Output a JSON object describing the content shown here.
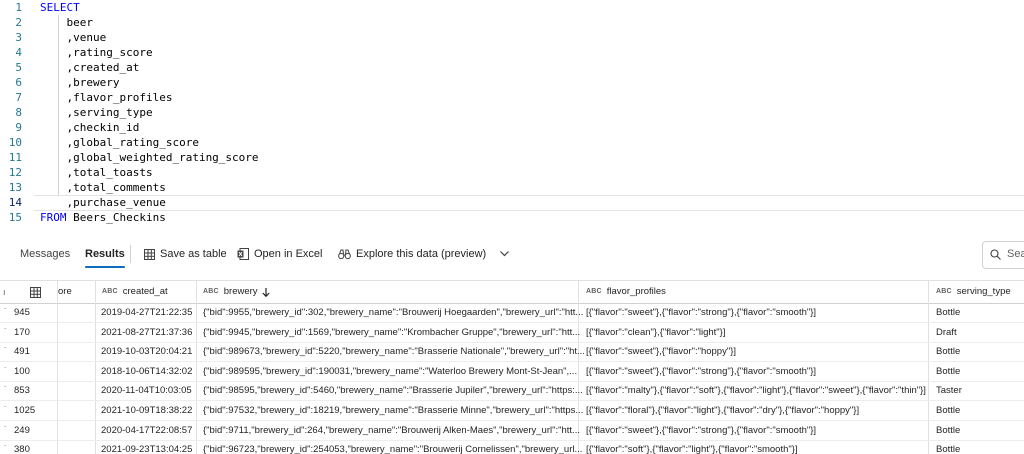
{
  "editor": {
    "lines": [
      {
        "n": "1",
        "kw": "SELECT",
        "text": ""
      },
      {
        "n": "2",
        "kw": "",
        "text": "    beer"
      },
      {
        "n": "3",
        "kw": "",
        "text": "    ,venue"
      },
      {
        "n": "4",
        "kw": "",
        "text": "    ,rating_score"
      },
      {
        "n": "5",
        "kw": "",
        "text": "    ,created_at"
      },
      {
        "n": "6",
        "kw": "",
        "text": "    ,brewery"
      },
      {
        "n": "7",
        "kw": "",
        "text": "    ,flavor_profiles"
      },
      {
        "n": "8",
        "kw": "",
        "text": "    ,serving_type"
      },
      {
        "n": "9",
        "kw": "",
        "text": "    ,checkin_id"
      },
      {
        "n": "10",
        "kw": "",
        "text": "    ,global_rating_score"
      },
      {
        "n": "11",
        "kw": "",
        "text": "    ,global_weighted_rating_score"
      },
      {
        "n": "12",
        "kw": "",
        "text": "    ,total_toasts"
      },
      {
        "n": "13",
        "kw": "",
        "text": "    ,total_comments"
      },
      {
        "n": "14",
        "kw": "",
        "text": "    ,purchase_venue"
      },
      {
        "n": "15",
        "kw": "FROM",
        "text": " Beers_Checkins"
      }
    ]
  },
  "toolbar": {
    "tabs": [
      "Messages",
      "Results"
    ],
    "save_as_table": "Save as table",
    "open_in_excel": "Open in Excel",
    "explore": "Explore this data (preview)",
    "search_placeholder": "Sea"
  },
  "grid": {
    "columns": [
      {
        "type": "",
        "label": "ore"
      },
      {
        "type": "ABC",
        "label": "created_at"
      },
      {
        "type": "ABC",
        "label": "brewery"
      },
      {
        "type": "ABC",
        "label": "flavor_profiles"
      },
      {
        "type": "ABC",
        "label": "serving_type"
      }
    ],
    "rows": [
      {
        "c0": "945",
        "created_at": "2019-04-27T21:22:35",
        "brewery": "{\"bid\":9955,\"brewery_id\":302,\"brewery_name\":\"Brouwerij Hoegaarden\",\"brewery_url\":\"htt...",
        "flavor": "[{\"flavor\":\"sweet\"},{\"flavor\":\"strong\"},{\"flavor\":\"smooth\"}]",
        "serving": "Bottle"
      },
      {
        "c0": "170",
        "created_at": "2021-08-27T21:37:36",
        "brewery": "{\"bid\":9945,\"brewery_id\":1569,\"brewery_name\":\"Krombacher Gruppe\",\"brewery_url\":\"htt...",
        "flavor": "[{\"flavor\":\"clean\"},{\"flavor\":\"light\"}]",
        "serving": "Draft"
      },
      {
        "c0": "491",
        "created_at": "2019-10-03T20:04:21",
        "brewery": "{\"bid\":989673,\"brewery_id\":5220,\"brewery_name\":\"Brasserie Nationale\",\"brewery_url\":\"ht...",
        "flavor": "[{\"flavor\":\"sweet\"},{\"flavor\":\"hoppy\"}]",
        "serving": "Bottle"
      },
      {
        "c0": "100",
        "created_at": "2018-10-06T14:32:02",
        "brewery": "{\"bid\":989595,\"brewery_id\":190031,\"brewery_name\":\"Waterloo Brewery Mont-St-Jean\",...",
        "flavor": "[{\"flavor\":\"sweet\"},{\"flavor\":\"strong\"},{\"flavor\":\"smooth\"}]",
        "serving": "Bottle"
      },
      {
        "c0": "853",
        "created_at": "2020-11-04T10:03:05",
        "brewery": "{\"bid\":98595,\"brewery_id\":5460,\"brewery_name\":\"Brasserie Jupiler\",\"brewery_url\":\"https:...",
        "flavor": "[{\"flavor\":\"malty\"},{\"flavor\":\"soft\"},{\"flavor\":\"light\"},{\"flavor\":\"sweet\"},{\"flavor\":\"thin\"}]",
        "serving": "Taster"
      },
      {
        "c0": "1025",
        "created_at": "2021-10-09T18:38:22",
        "brewery": "{\"bid\":97532,\"brewery_id\":18219,\"brewery_name\":\"Brasserie Minne\",\"brewery_url\":\"https...",
        "flavor": "[{\"flavor\":\"floral\"},{\"flavor\":\"light\"},{\"flavor\":\"dry\"},{\"flavor\":\"hoppy\"}]",
        "serving": "Bottle"
      },
      {
        "c0": "249",
        "created_at": "2020-04-17T22:08:57",
        "brewery": "{\"bid\":9711,\"brewery_id\":264,\"brewery_name\":\"Brouwerij Alken-Maes\",\"brewery_url\":\"htt...",
        "flavor": "[{\"flavor\":\"sweet\"},{\"flavor\":\"strong\"},{\"flavor\":\"smooth\"}]",
        "serving": "Bottle"
      },
      {
        "c0": "380",
        "created_at": "2021-09-23T13:04:25",
        "brewery": "{\"bid\":96723,\"brewery_id\":254053,\"brewery_name\":\"Brouwerij Cornelissen\",\"brewery_url...",
        "flavor": "[{\"flavor\":\"soft\"},{\"flavor\":\"light\"},{\"flavor\":\"smooth\"}]",
        "serving": "Bottle"
      }
    ]
  }
}
